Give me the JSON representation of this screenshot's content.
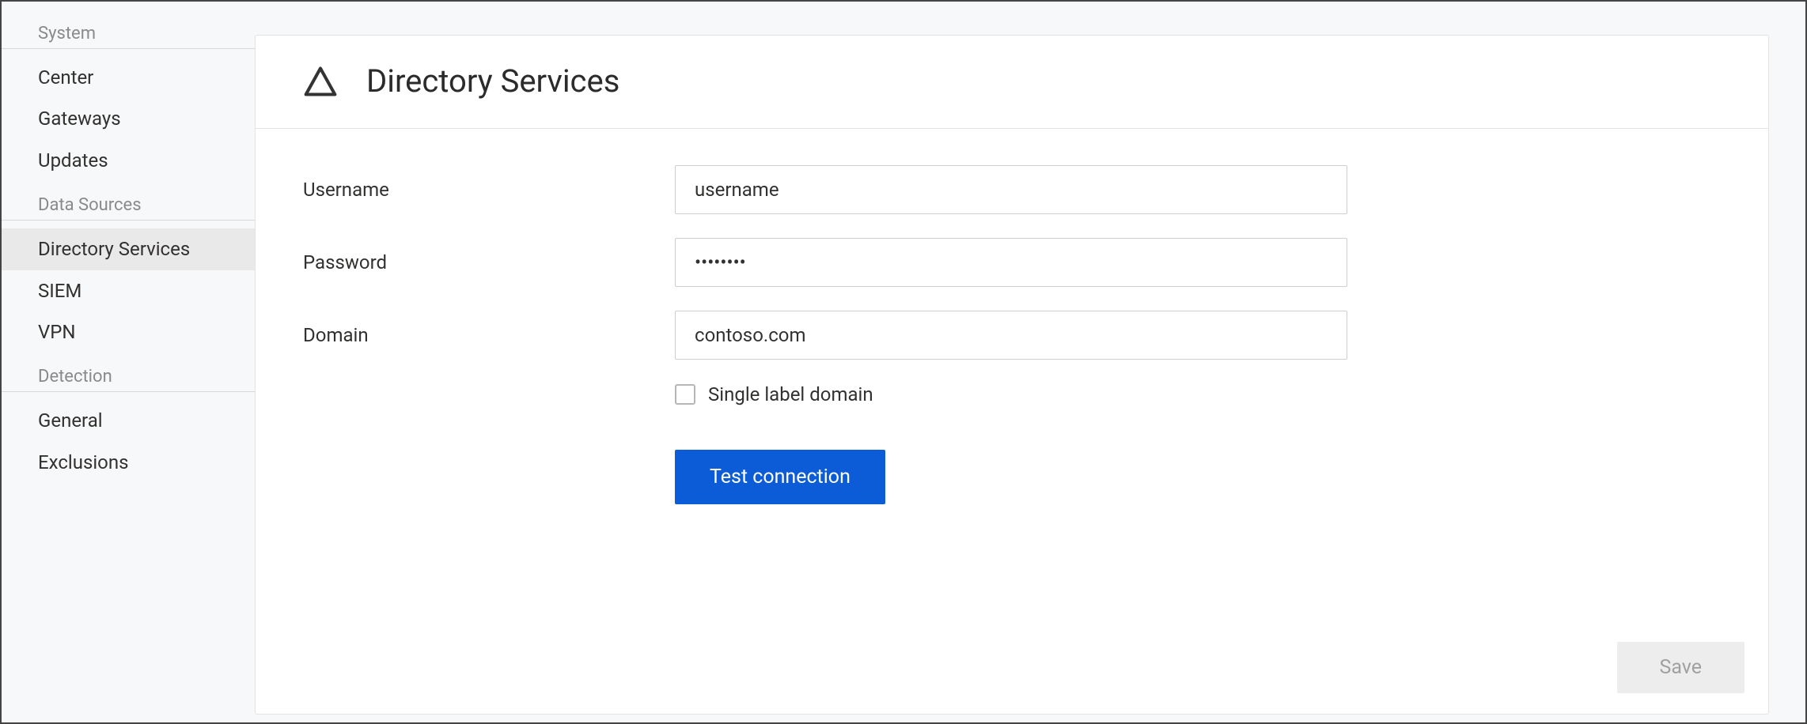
{
  "sidebar": {
    "sections": [
      {
        "heading": "System",
        "items": [
          {
            "label": "Center",
            "active": false
          },
          {
            "label": "Gateways",
            "active": false
          },
          {
            "label": "Updates",
            "active": false
          }
        ]
      },
      {
        "heading": "Data Sources",
        "items": [
          {
            "label": "Directory Services",
            "active": true
          },
          {
            "label": "SIEM",
            "active": false
          },
          {
            "label": "VPN",
            "active": false
          }
        ]
      },
      {
        "heading": "Detection",
        "items": [
          {
            "label": "General",
            "active": false
          },
          {
            "label": "Exclusions",
            "active": false
          }
        ]
      }
    ]
  },
  "page": {
    "title": "Directory Services",
    "icon": "warning-triangle-icon"
  },
  "form": {
    "username_label": "Username",
    "username_value": "username",
    "password_label": "Password",
    "password_value": "••••••••",
    "domain_label": "Domain",
    "domain_value": "contoso.com",
    "single_label_domain_label": "Single label domain",
    "single_label_domain_checked": false,
    "test_connection_label": "Test connection",
    "save_label": "Save"
  }
}
